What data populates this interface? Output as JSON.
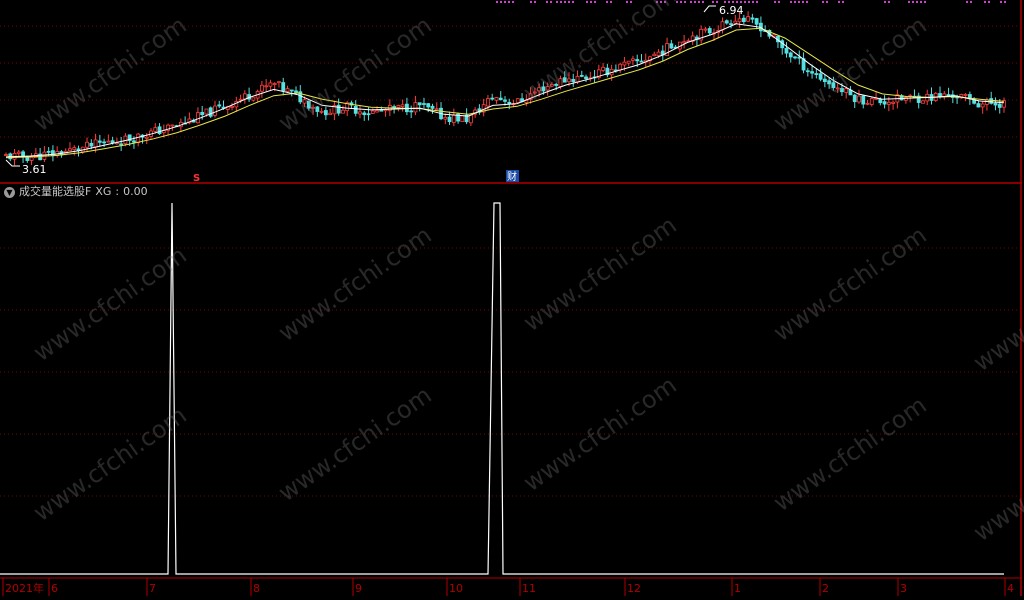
{
  "panel": {
    "indicator_name": "成交量能选股F",
    "series_label": "XG",
    "series_value": "0.00"
  },
  "price_panel": {
    "high_label": "6.94",
    "low_label": "3.61",
    "marker_s": "S",
    "marker_cai": "财"
  },
  "watermark_text": "www.cfchi.com",
  "colors": {
    "background": "#000000",
    "grid": "#7a0000",
    "axis": "#b00000",
    "up": "#ff3d3d",
    "down": "#54e1e1",
    "ma_short": "#ffffff",
    "ma_long": "#e6e64a",
    "signal_line": "#ffffff",
    "top_markers": "#d23cd2"
  },
  "chart_data": [
    {
      "type": "candlestick",
      "title": "",
      "period": "2021-05 to 2022-04",
      "close_approx": [
        3.72,
        3.7,
        3.78,
        3.88,
        4.02,
        4.1,
        4.25,
        4.4,
        4.62,
        4.85,
        5.1,
        5.35,
        5.05,
        4.72,
        4.82,
        4.7,
        4.78,
        4.86,
        4.6,
        4.55,
        5.05,
        4.92,
        5.25,
        5.45,
        5.52,
        5.7,
        5.85,
        6.1,
        6.4,
        6.55,
        6.85,
        6.65,
        6.1,
        5.65,
        5.3,
        5.0,
        4.95,
        5.02,
        5.05,
        5.1,
        4.9,
        4.92
      ],
      "ma_short": [
        3.7,
        3.72,
        3.76,
        3.84,
        3.96,
        4.08,
        4.22,
        4.38,
        4.58,
        4.8,
        5.04,
        5.22,
        5.1,
        4.86,
        4.8,
        4.76,
        4.78,
        4.8,
        4.66,
        4.62,
        4.86,
        4.9,
        5.12,
        5.32,
        5.46,
        5.62,
        5.78,
        6.0,
        6.28,
        6.46,
        6.7,
        6.62,
        6.22,
        5.8,
        5.42,
        5.12,
        5.0,
        5.02,
        5.04,
        5.08,
        4.96,
        4.92
      ],
      "ma_long": [
        3.68,
        3.7,
        3.73,
        3.79,
        3.88,
        3.98,
        4.1,
        4.24,
        4.42,
        4.62,
        4.86,
        5.08,
        5.14,
        5.0,
        4.9,
        4.82,
        4.8,
        4.79,
        4.72,
        4.66,
        4.78,
        4.84,
        5.0,
        5.18,
        5.34,
        5.5,
        5.66,
        5.86,
        6.12,
        6.32,
        6.56,
        6.6,
        6.38,
        6.02,
        5.66,
        5.32,
        5.12,
        5.06,
        5.04,
        5.06,
        5.0,
        4.95
      ],
      "annotations": [
        {
          "label": "6.94",
          "kind": "high"
        },
        {
          "label": "3.61",
          "kind": "low"
        }
      ]
    },
    {
      "type": "line",
      "title": "成交量能选股F",
      "series": [
        {
          "name": "XG",
          "current": 0.0
        }
      ],
      "x_ticks": [
        "2021年",
        "6",
        "7",
        "8",
        "9",
        "10",
        "11",
        "12",
        "1",
        "2",
        "3",
        "4"
      ],
      "ylim": [
        0,
        1
      ],
      "signal_periods": [
        "7",
        "10"
      ],
      "grid": true
    }
  ]
}
